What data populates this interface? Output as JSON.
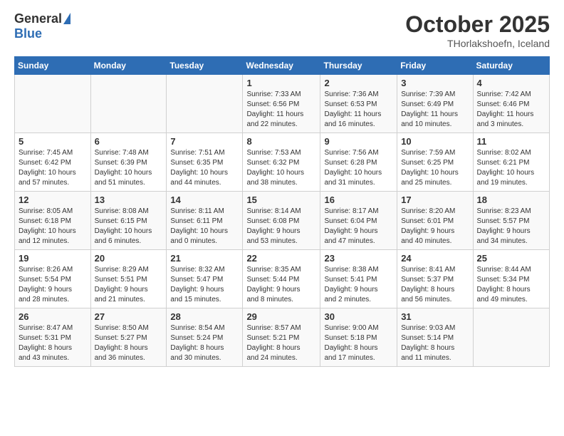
{
  "header": {
    "logo_general": "General",
    "logo_blue": "Blue",
    "month": "October 2025",
    "location": "THorlakshoefn, Iceland"
  },
  "days_of_week": [
    "Sunday",
    "Monday",
    "Tuesday",
    "Wednesday",
    "Thursday",
    "Friday",
    "Saturday"
  ],
  "weeks": [
    [
      {
        "day": "",
        "info": ""
      },
      {
        "day": "",
        "info": ""
      },
      {
        "day": "",
        "info": ""
      },
      {
        "day": "1",
        "info": "Sunrise: 7:33 AM\nSunset: 6:56 PM\nDaylight: 11 hours\nand 22 minutes."
      },
      {
        "day": "2",
        "info": "Sunrise: 7:36 AM\nSunset: 6:53 PM\nDaylight: 11 hours\nand 16 minutes."
      },
      {
        "day": "3",
        "info": "Sunrise: 7:39 AM\nSunset: 6:49 PM\nDaylight: 11 hours\nand 10 minutes."
      },
      {
        "day": "4",
        "info": "Sunrise: 7:42 AM\nSunset: 6:46 PM\nDaylight: 11 hours\nand 3 minutes."
      }
    ],
    [
      {
        "day": "5",
        "info": "Sunrise: 7:45 AM\nSunset: 6:42 PM\nDaylight: 10 hours\nand 57 minutes."
      },
      {
        "day": "6",
        "info": "Sunrise: 7:48 AM\nSunset: 6:39 PM\nDaylight: 10 hours\nand 51 minutes."
      },
      {
        "day": "7",
        "info": "Sunrise: 7:51 AM\nSunset: 6:35 PM\nDaylight: 10 hours\nand 44 minutes."
      },
      {
        "day": "8",
        "info": "Sunrise: 7:53 AM\nSunset: 6:32 PM\nDaylight: 10 hours\nand 38 minutes."
      },
      {
        "day": "9",
        "info": "Sunrise: 7:56 AM\nSunset: 6:28 PM\nDaylight: 10 hours\nand 31 minutes."
      },
      {
        "day": "10",
        "info": "Sunrise: 7:59 AM\nSunset: 6:25 PM\nDaylight: 10 hours\nand 25 minutes."
      },
      {
        "day": "11",
        "info": "Sunrise: 8:02 AM\nSunset: 6:21 PM\nDaylight: 10 hours\nand 19 minutes."
      }
    ],
    [
      {
        "day": "12",
        "info": "Sunrise: 8:05 AM\nSunset: 6:18 PM\nDaylight: 10 hours\nand 12 minutes."
      },
      {
        "day": "13",
        "info": "Sunrise: 8:08 AM\nSunset: 6:15 PM\nDaylight: 10 hours\nand 6 minutes."
      },
      {
        "day": "14",
        "info": "Sunrise: 8:11 AM\nSunset: 6:11 PM\nDaylight: 10 hours\nand 0 minutes."
      },
      {
        "day": "15",
        "info": "Sunrise: 8:14 AM\nSunset: 6:08 PM\nDaylight: 9 hours\nand 53 minutes."
      },
      {
        "day": "16",
        "info": "Sunrise: 8:17 AM\nSunset: 6:04 PM\nDaylight: 9 hours\nand 47 minutes."
      },
      {
        "day": "17",
        "info": "Sunrise: 8:20 AM\nSunset: 6:01 PM\nDaylight: 9 hours\nand 40 minutes."
      },
      {
        "day": "18",
        "info": "Sunrise: 8:23 AM\nSunset: 5:57 PM\nDaylight: 9 hours\nand 34 minutes."
      }
    ],
    [
      {
        "day": "19",
        "info": "Sunrise: 8:26 AM\nSunset: 5:54 PM\nDaylight: 9 hours\nand 28 minutes."
      },
      {
        "day": "20",
        "info": "Sunrise: 8:29 AM\nSunset: 5:51 PM\nDaylight: 9 hours\nand 21 minutes."
      },
      {
        "day": "21",
        "info": "Sunrise: 8:32 AM\nSunset: 5:47 PM\nDaylight: 9 hours\nand 15 minutes."
      },
      {
        "day": "22",
        "info": "Sunrise: 8:35 AM\nSunset: 5:44 PM\nDaylight: 9 hours\nand 8 minutes."
      },
      {
        "day": "23",
        "info": "Sunrise: 8:38 AM\nSunset: 5:41 PM\nDaylight: 9 hours\nand 2 minutes."
      },
      {
        "day": "24",
        "info": "Sunrise: 8:41 AM\nSunset: 5:37 PM\nDaylight: 8 hours\nand 56 minutes."
      },
      {
        "day": "25",
        "info": "Sunrise: 8:44 AM\nSunset: 5:34 PM\nDaylight: 8 hours\nand 49 minutes."
      }
    ],
    [
      {
        "day": "26",
        "info": "Sunrise: 8:47 AM\nSunset: 5:31 PM\nDaylight: 8 hours\nand 43 minutes."
      },
      {
        "day": "27",
        "info": "Sunrise: 8:50 AM\nSunset: 5:27 PM\nDaylight: 8 hours\nand 36 minutes."
      },
      {
        "day": "28",
        "info": "Sunrise: 8:54 AM\nSunset: 5:24 PM\nDaylight: 8 hours\nand 30 minutes."
      },
      {
        "day": "29",
        "info": "Sunrise: 8:57 AM\nSunset: 5:21 PM\nDaylight: 8 hours\nand 24 minutes."
      },
      {
        "day": "30",
        "info": "Sunrise: 9:00 AM\nSunset: 5:18 PM\nDaylight: 8 hours\nand 17 minutes."
      },
      {
        "day": "31",
        "info": "Sunrise: 9:03 AM\nSunset: 5:14 PM\nDaylight: 8 hours\nand 11 minutes."
      },
      {
        "day": "",
        "info": ""
      }
    ]
  ]
}
